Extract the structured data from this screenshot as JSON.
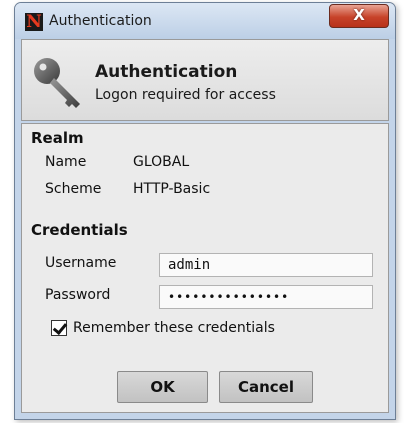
{
  "window": {
    "title": "Authentication",
    "app_icon_letter": "N",
    "close_glyph": "X"
  },
  "header": {
    "icon": "key-icon",
    "title": "Authentication",
    "subtitle": "Logon required for access"
  },
  "realm": {
    "section_title": "Realm",
    "name_label": "Name",
    "name_value": "GLOBAL",
    "scheme_label": "Scheme",
    "scheme_value": "HTTP-Basic"
  },
  "credentials": {
    "section_title": "Credentials",
    "username_label": "Username",
    "username_value": "admin",
    "password_label": "Password",
    "password_value": "•••••••••••••••",
    "remember_label": "Remember these credentials",
    "remember_checked": true
  },
  "buttons": {
    "ok_label": "OK",
    "cancel_label": "Cancel"
  },
  "colors": {
    "close_button": "#c7432a",
    "window_frame": "#c3d4e9",
    "app_icon_accent": "#e53a1f"
  }
}
